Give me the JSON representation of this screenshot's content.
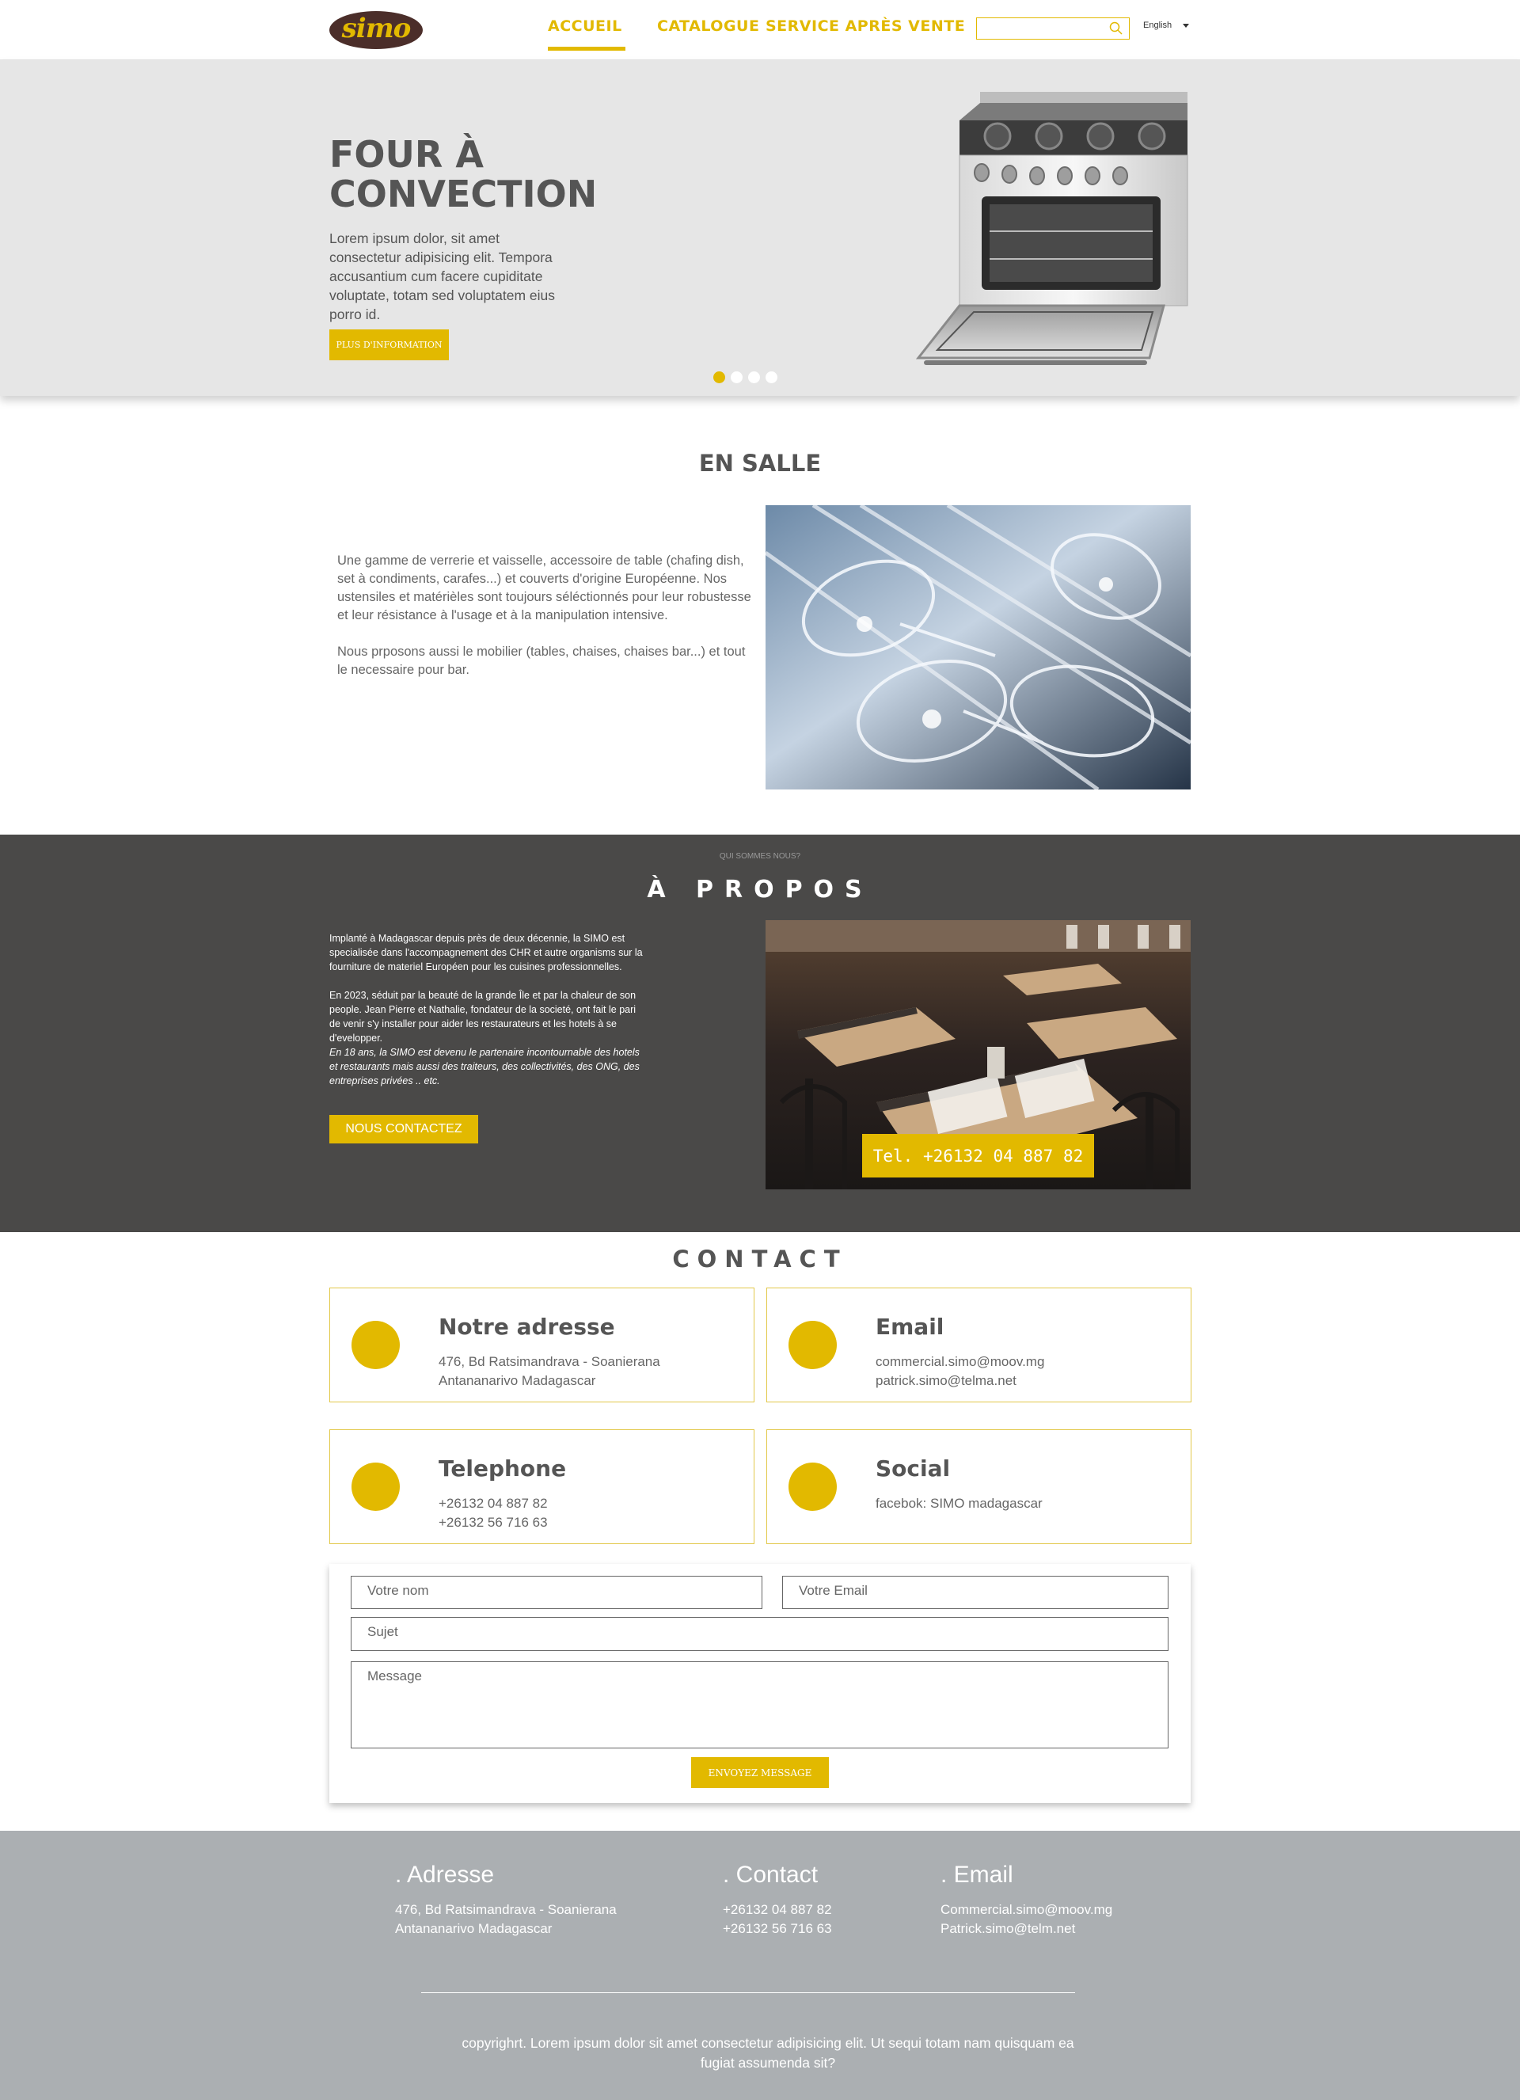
{
  "header": {
    "logo_text": "simo",
    "nav": [
      "ACCUEIL",
      "CATALOGUE",
      "SERVICE APRÈS VENTE"
    ],
    "search_placeholder": "",
    "language": "English"
  },
  "hero": {
    "title": "FOUR À CONVECTION",
    "text": "Lorem ipsum dolor, sit amet consectetur adipisicing elit. Tempora accusantium cum facere cupiditate voluptate, totam sed voluptatem eius porro id.",
    "button": "PLUS D'INFORMATION",
    "slides": 4,
    "active_slide": 1,
    "image_icon": "convection-oven-image"
  },
  "salle": {
    "title": "EN SALLE",
    "paragraph1": "Une gamme de verrerie et vaisselle, accessoire de table (chafing dish, set à condiments, carafes...) et couverts d'origine Européenne. Nos ustensiles et matérièles sont toujours séléctionnés pour leur robustesse et leur résistance à l'usage et à la manipulation intensive.",
    "paragraph2": "Nous prposons aussi le mobilier (tables, chaises, chaises bar...) et tout le necessaire pour bar.",
    "image_icon": "wine-glasses-rack-image"
  },
  "propos": {
    "kicker": "QUI SOMMES NOUS?",
    "title": "À PROPOS",
    "paragraph1": "Implanté à Madagascar depuis près de deux décennie, la SIMO est specialisée dans l'accompagnement des CHR et autre organisms sur la fourniture de materiel Européen pour les cuisines professionnelles.",
    "paragraph2": "En 2023, séduit par la beauté de la grande Île et par la chaleur de son people. Jean Pierre et Nathalie, fondateur de la societé, ont fait le pari de venir s'y installer pour aider les restaurateurs et les hotels à se d'evelopper.",
    "paragraph3": "En 18 ans, la SIMO est devenu le partenaire incontournable des hotels et restaurants mais aussi des traiteurs, des collectivités, des ONG, des entreprises privées .. etc.",
    "button": "NOUS CONTACTEZ",
    "phone_badge": "Tel. +26132 04 887 82",
    "image_icon": "restaurant-tables-image"
  },
  "contact": {
    "title": "CONTACT",
    "cards": [
      {
        "title": "Notre adresse",
        "lines": [
          "476, Bd Ratsimandrava - Soanierana",
          "Antananarivo Madagascar"
        ]
      },
      {
        "title": "Email",
        "lines": [
          "commercial.simo@moov.mg",
          "patrick.simo@telma.net"
        ]
      },
      {
        "title": "Telephone",
        "lines": [
          "+26132 04 887 82",
          "+26132 56 716 63"
        ]
      },
      {
        "title": "Social",
        "lines": [
          "facebok: SIMO madagascar"
        ]
      }
    ],
    "form": {
      "name_placeholder": "Votre nom",
      "email_placeholder": "Votre Email",
      "subject_placeholder": "Sujet",
      "message_placeholder": "Message",
      "send": "ENVOYEZ MESSAGE"
    }
  },
  "footer": {
    "columns": [
      {
        "title": ". Adresse",
        "lines": [
          "476, Bd Ratsimandrava - Soanierana",
          "Antananarivo Madagascar"
        ]
      },
      {
        "title": ". Contact",
        "lines": [
          "+26132 04 887 82",
          "+26132 56 716 63"
        ]
      },
      {
        "title": ". Email",
        "lines": [
          "Commercial.simo@moov.mg",
          "Patrick.simo@telm.net"
        ]
      }
    ],
    "copyright": "copyrighrt. Lorem ipsum dolor sit amet consectetur adipisicing elit. Ut sequi totam nam quisquam ea fugiat assumenda sit?"
  },
  "colors": {
    "accent": "#e2b900",
    "dark": "#4a4948",
    "footer": "#abafb2",
    "hero_bg": "#e6e6e6"
  }
}
